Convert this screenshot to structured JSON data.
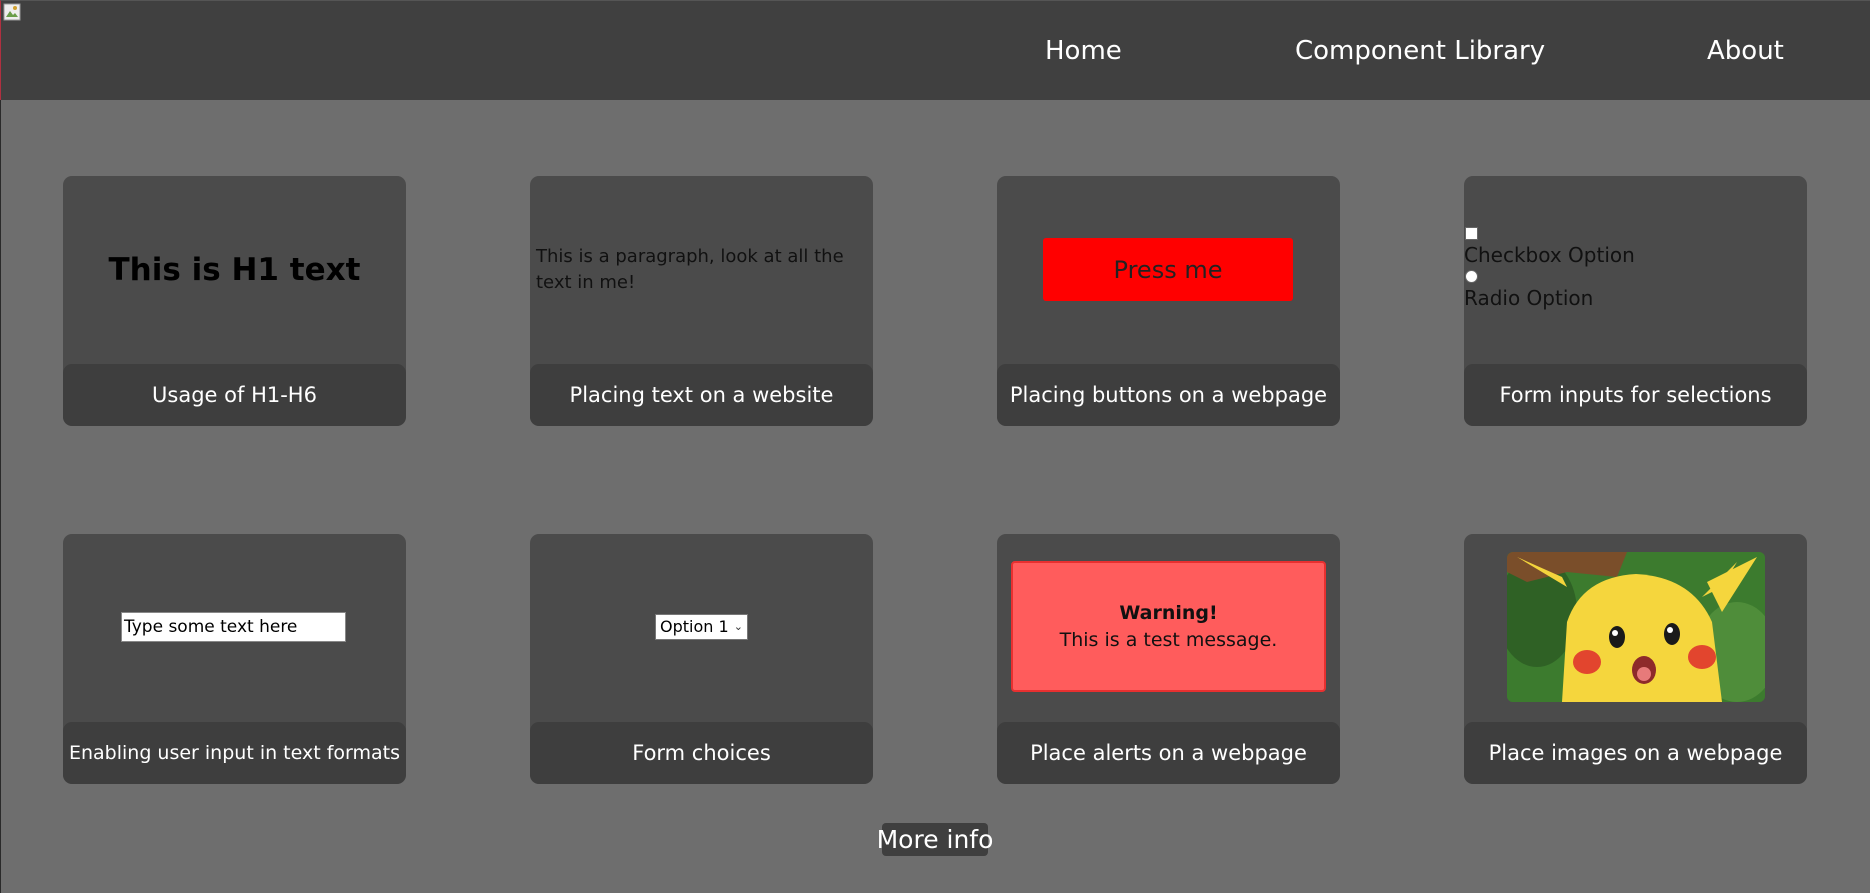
{
  "nav": {
    "links": [
      "Home",
      "Component Library",
      "About"
    ]
  },
  "cards": [
    {
      "preview_text": "This is H1 text",
      "footer": "Usage of H1-H6"
    },
    {
      "preview_text": "This is a paragraph, look at all the text in me!",
      "footer": "Placing text on a website"
    },
    {
      "preview_text": "Press me",
      "footer": "Placing buttons on a webpage"
    },
    {
      "checkbox_label": "Checkbox Option",
      "radio_label": "Radio Option",
      "footer": "Form inputs for selections"
    },
    {
      "input_value": "Type some text here",
      "footer": "Enabling user input in text formats"
    },
    {
      "select_value": "Option 1",
      "footer": "Form choices"
    },
    {
      "alert_title": "Warning!",
      "alert_message": "This is a test message.",
      "footer": "Place alerts on a webpage"
    },
    {
      "image_icon": "pikachu-image",
      "footer": "Place images on a webpage"
    }
  ],
  "more_info": "More info",
  "colors": {
    "navbar": "#404040",
    "background": "#6e6e6e",
    "card": "#4b4b4b",
    "card_footer": "#3e3e3e",
    "button_red": "#ff0000",
    "alert_red": "#ff5c5c"
  }
}
